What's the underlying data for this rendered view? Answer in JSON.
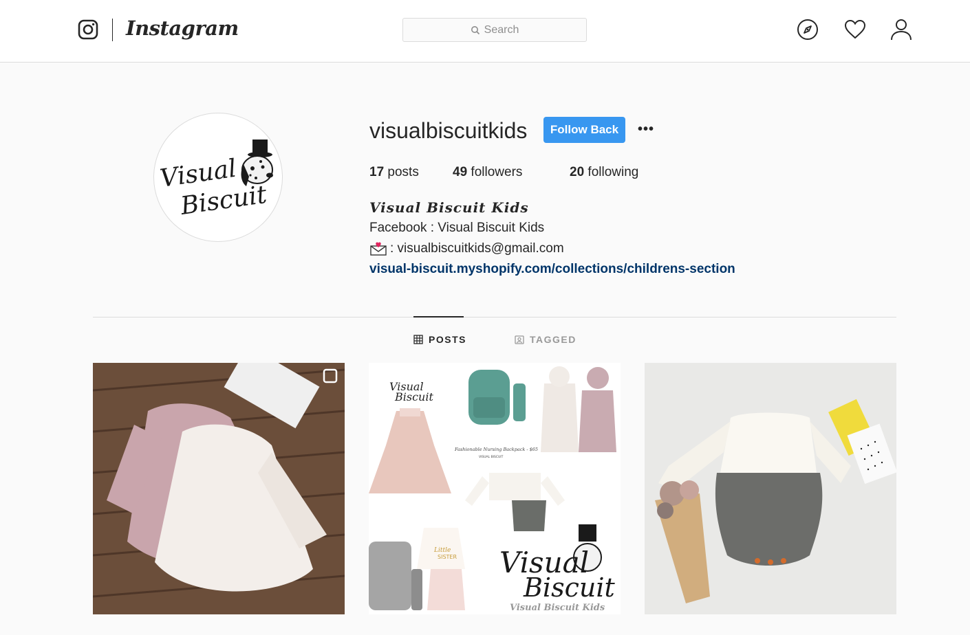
{
  "topnav": {
    "wordmark": "Instagram",
    "search_placeholder": "Search",
    "icons": [
      "instagram-glyph-icon",
      "search-icon",
      "compass-icon",
      "heart-icon",
      "person-icon"
    ]
  },
  "profile": {
    "username": "visualbiscuitkids",
    "follow_label": "Follow Back",
    "more_label": "•••",
    "stats": {
      "posts_count": "17",
      "posts_label": " posts",
      "followers_count": "49",
      "followers_label": " followers",
      "following_count": "20",
      "following_label": " following"
    },
    "bio": {
      "name": "Visual Biscuit Kids",
      "line1": "Facebook : Visual Biscuit Kids",
      "line2": " : visualbiscuitkids@gmail.com",
      "link": "visual-biscuit.myshopify.com/collections/childrens-section"
    },
    "avatar_logo_text": "Visual Biscuit"
  },
  "tabs": [
    {
      "label": "POSTS",
      "icon": "grid-icon",
      "active": true
    },
    {
      "label": "TAGGED",
      "icon": "tag-icon",
      "active": false
    }
  ],
  "posts": [
    {
      "description": "lace dresses on wooden floor",
      "multi": true
    },
    {
      "description": "baby clothing collage",
      "caption": "Fashionable Nursing Backpack - $65",
      "brand": "VISUAL BISCUIT",
      "overlay_text": "Visual Biscuit Kids"
    },
    {
      "description": "knit romper with flowers"
    }
  ],
  "colors": {
    "accent": "#3897f0",
    "link": "#003569",
    "border": "#dbdbdb",
    "background": "#fafafa"
  }
}
